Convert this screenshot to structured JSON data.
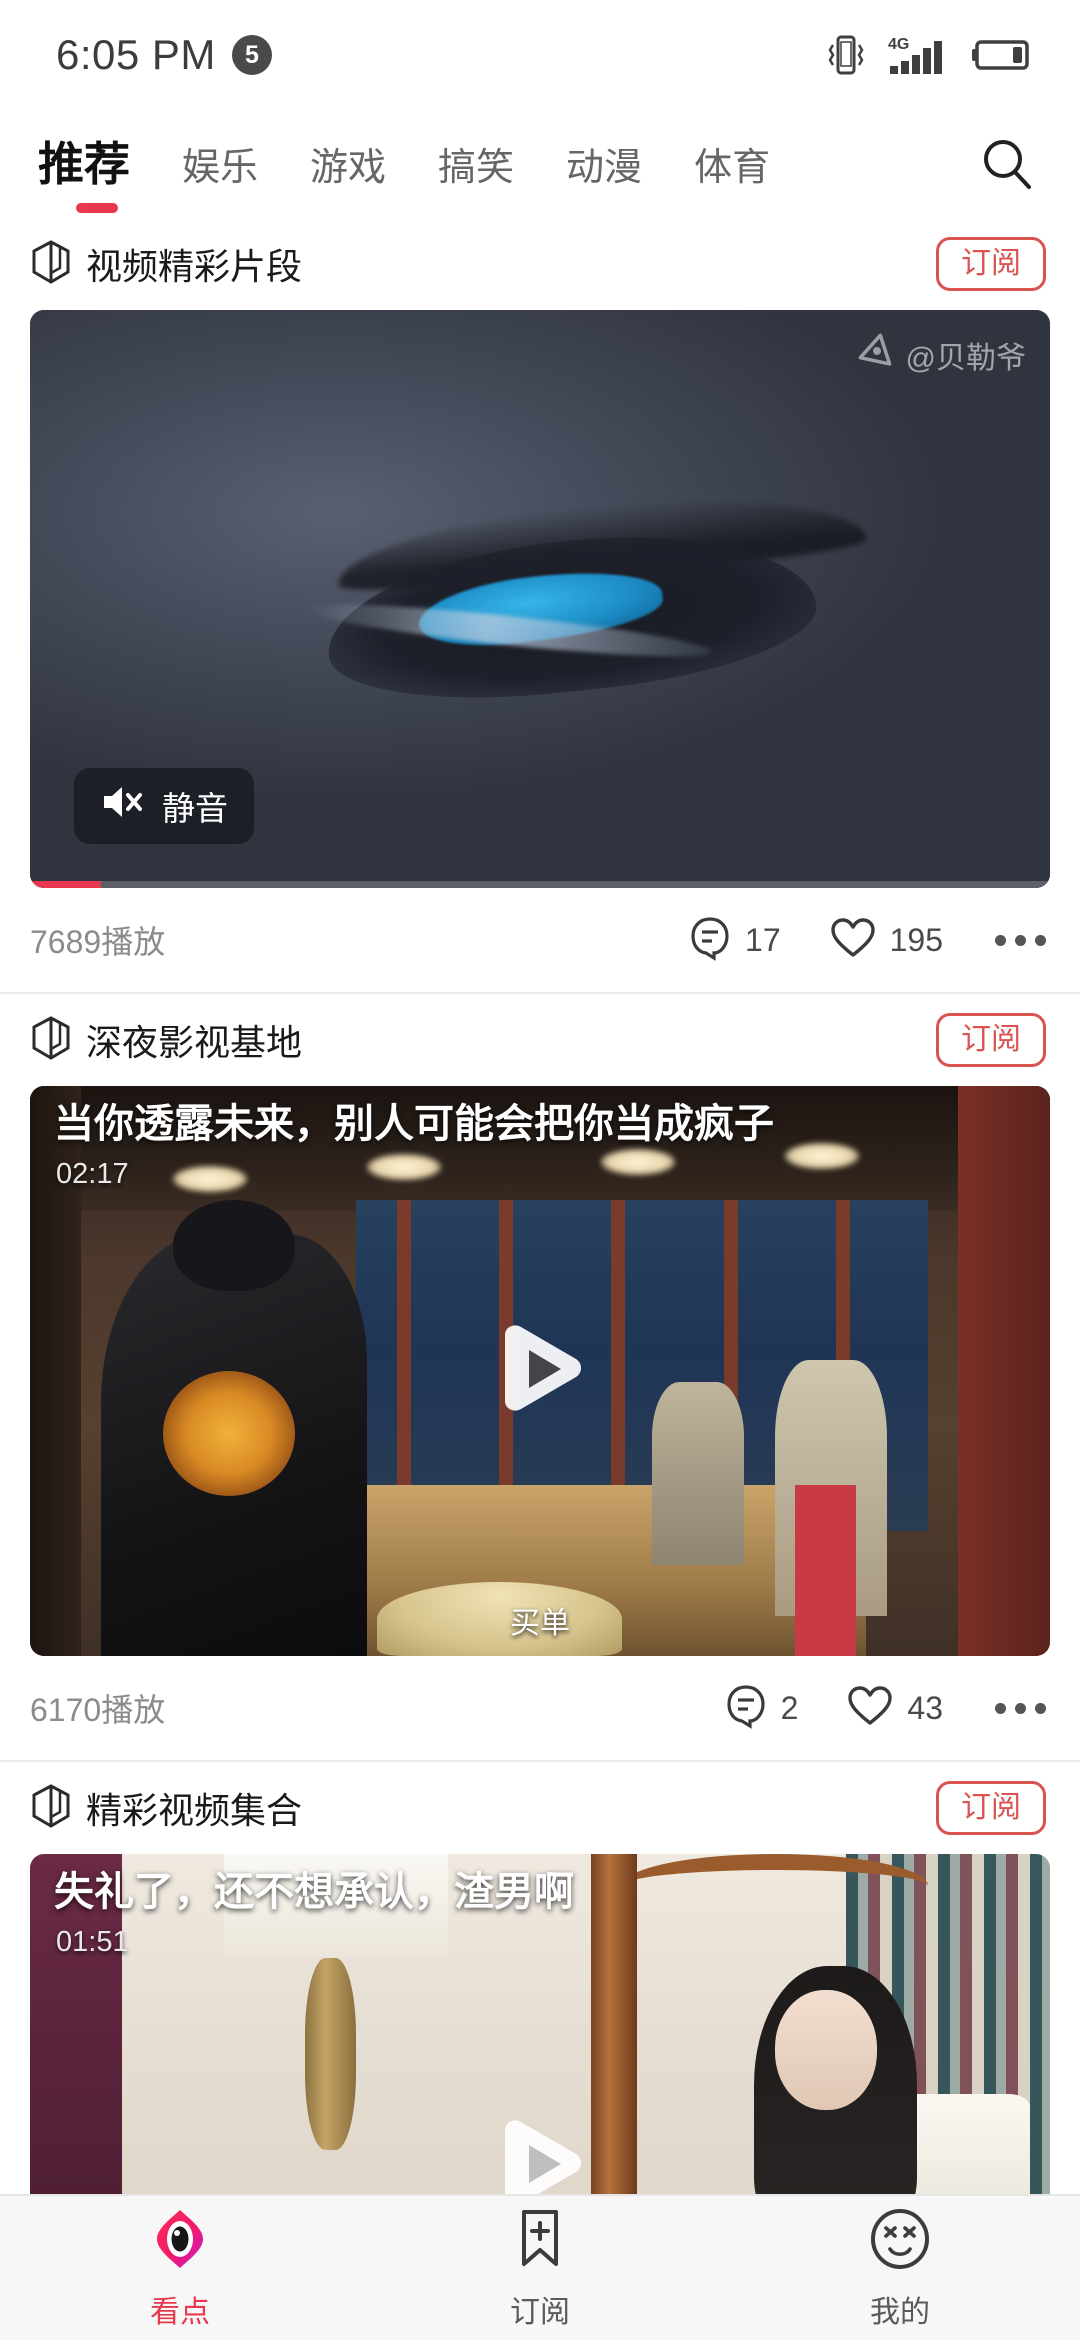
{
  "status_bar": {
    "time": "6:05 PM",
    "badge_count": "5",
    "icons": [
      "vibrate-icon",
      "signal-4g-icon",
      "battery-icon"
    ],
    "network_label": "4G"
  },
  "top_nav": {
    "tabs": [
      {
        "label": "推荐",
        "active": true
      },
      {
        "label": "娱乐",
        "active": false
      },
      {
        "label": "游戏",
        "active": false
      },
      {
        "label": "搞笑",
        "active": false
      },
      {
        "label": "动漫",
        "active": false
      },
      {
        "label": "体育",
        "active": false
      }
    ],
    "search_icon": "search-icon",
    "accent_color": "#e8384f"
  },
  "feed": [
    {
      "channel": "视频精彩片段",
      "channel_icon": "box-3d-icon",
      "subscribe_label": "订阅",
      "video": {
        "title": "",
        "duration": "",
        "watermark": "@贝勒爷",
        "watermark_icon": "play-badge-icon",
        "mute_label": "静音",
        "mute_icon": "speaker-mute-icon",
        "playing": true,
        "progress_percent": "7"
      },
      "plays": "7689播放",
      "comments": "17",
      "likes": "195",
      "comment_icon": "comment-icon",
      "like_icon": "heart-icon",
      "more_icon": "more-dots-icon"
    },
    {
      "channel": "深夜影视基地",
      "channel_icon": "box-3d-icon",
      "subscribe_label": "订阅",
      "video": {
        "title": "当你透露未来，别人可能会把你当成疯子",
        "duration": "02:17",
        "subtitle": "买单",
        "play_icon": "play-triangle-icon",
        "playing": false
      },
      "plays": "6170播放",
      "comments": "2",
      "likes": "43",
      "comment_icon": "comment-icon",
      "like_icon": "heart-icon",
      "more_icon": "more-dots-icon"
    },
    {
      "channel": "精彩视频集合",
      "channel_icon": "box-3d-icon",
      "subscribe_label": "订阅",
      "video": {
        "title": "失礼了，还不想承认，渣男啊",
        "duration": "01:51",
        "play_icon": "play-triangle-icon",
        "playing": false
      }
    }
  ],
  "bottom_nav": {
    "items": [
      {
        "label": "看点",
        "icon": "eye-diamond-icon",
        "active": true
      },
      {
        "label": "订阅",
        "icon": "bookmark-plus-icon",
        "active": false
      },
      {
        "label": "我的",
        "icon": "face-icon",
        "active": false
      }
    ],
    "active_color": "#e8384f"
  }
}
